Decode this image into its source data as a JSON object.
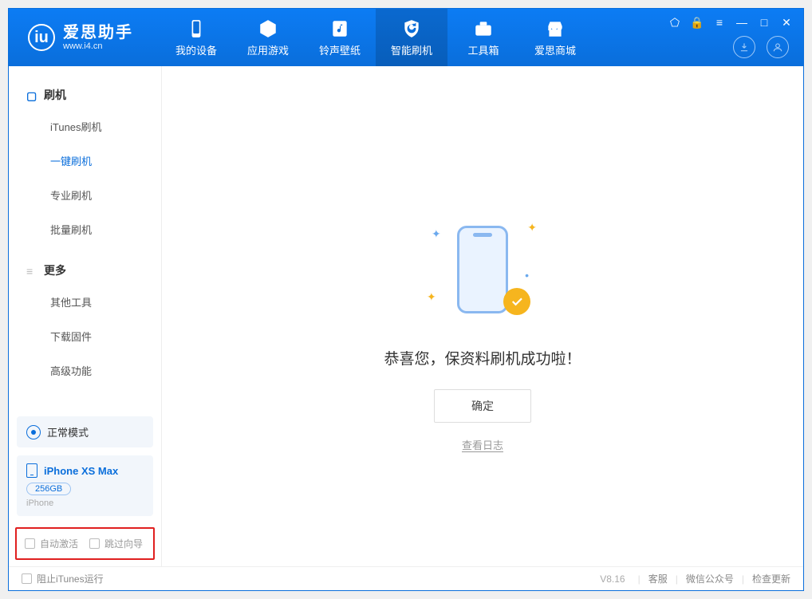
{
  "brand": {
    "title": "爱思助手",
    "url": "www.i4.cn"
  },
  "tabs": [
    {
      "label": "我的设备"
    },
    {
      "label": "应用游戏"
    },
    {
      "label": "铃声壁纸"
    },
    {
      "label": "智能刷机"
    },
    {
      "label": "工具箱"
    },
    {
      "label": "爱思商城"
    }
  ],
  "sidebar": {
    "group1": {
      "title": "刷机",
      "items": [
        "iTunes刷机",
        "一键刷机",
        "专业刷机",
        "批量刷机"
      ]
    },
    "group2": {
      "title": "更多",
      "items": [
        "其他工具",
        "下载固件",
        "高级功能"
      ]
    }
  },
  "mode": {
    "label": "正常模式"
  },
  "device": {
    "name": "iPhone XS Max",
    "capacity": "256GB",
    "type": "iPhone"
  },
  "bottom_checks": {
    "auto_activate": "自动激活",
    "skip_guide": "跳过向导"
  },
  "main": {
    "success_text": "恭喜您，保资料刷机成功啦！",
    "ok_button": "确定",
    "log_link": "查看日志"
  },
  "footer": {
    "block_itunes": "阻止iTunes运行",
    "version": "V8.16",
    "links": [
      "客服",
      "微信公众号",
      "检查更新"
    ]
  },
  "colors": {
    "primary": "#0a6edb",
    "accent": "#f6b51e"
  }
}
